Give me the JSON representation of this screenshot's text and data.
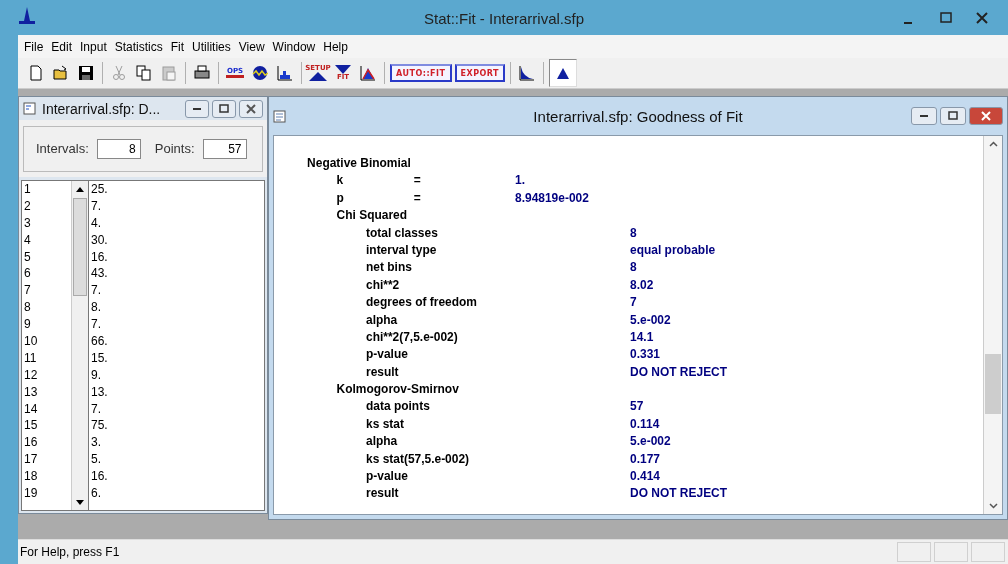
{
  "app_window": {
    "title": "Stat::Fit - Interarrival.sfp"
  },
  "menu": [
    "File",
    "Edit",
    "Input",
    "Statistics",
    "Fit",
    "Utilities",
    "View",
    "Window",
    "Help"
  ],
  "toolbar": [
    {
      "items": [
        {
          "kind": "new",
          "disabled": false,
          "pressed": false
        },
        {
          "kind": "open",
          "disabled": false,
          "pressed": false
        },
        {
          "kind": "save",
          "disabled": false,
          "pressed": false
        }
      ]
    },
    {
      "items": [
        {
          "kind": "cut",
          "disabled": true,
          "pressed": false
        },
        {
          "kind": "copy",
          "disabled": false,
          "pressed": false
        },
        {
          "kind": "paste",
          "disabled": true,
          "pressed": false
        }
      ]
    },
    {
      "items": [
        {
          "kind": "print",
          "disabled": false,
          "pressed": false
        }
      ]
    },
    {
      "items": [
        {
          "kind": "ops",
          "label": "OPS",
          "disabled": false,
          "pressed": false
        },
        {
          "kind": "wave",
          "disabled": false,
          "pressed": false
        },
        {
          "kind": "histogram",
          "disabled": false,
          "pressed": false
        }
      ]
    },
    {
      "items": [
        {
          "kind": "setup",
          "label": "SETUP",
          "disabled": false,
          "pressed": false
        },
        {
          "kind": "fit",
          "label": "FIT",
          "disabled": false,
          "pressed": false
        },
        {
          "kind": "compare",
          "disabled": false,
          "pressed": false
        }
      ]
    },
    {
      "items": [
        {
          "kind": "text",
          "label": "AUTO::FIT",
          "disabled": false,
          "pressed": false
        },
        {
          "kind": "text",
          "label": "EXPORT",
          "disabled": false,
          "pressed": false
        }
      ]
    },
    {
      "items": [
        {
          "kind": "curve",
          "disabled": false,
          "pressed": false
        }
      ]
    },
    {
      "items": [
        {
          "kind": "peak",
          "disabled": false,
          "pressed": true
        }
      ]
    }
  ],
  "data_window": {
    "title": "Interarrival.sfp: D...",
    "intervals_label": "Intervals:",
    "intervals": "8",
    "points_label": "Points:",
    "points": "57",
    "rows": [
      {
        "index": "1",
        "value": "25."
      },
      {
        "index": "2",
        "value": "7."
      },
      {
        "index": "3",
        "value": "4."
      },
      {
        "index": "4",
        "value": "30."
      },
      {
        "index": "5",
        "value": "16."
      },
      {
        "index": "6",
        "value": "43."
      },
      {
        "index": "7",
        "value": "7."
      },
      {
        "index": "8",
        "value": "8."
      },
      {
        "index": "9",
        "value": "7."
      },
      {
        "index": "10",
        "value": "66."
      },
      {
        "index": "11",
        "value": "15."
      },
      {
        "index": "12",
        "value": "9."
      },
      {
        "index": "13",
        "value": "13."
      },
      {
        "index": "14",
        "value": "7."
      },
      {
        "index": "15",
        "value": "75."
      },
      {
        "index": "16",
        "value": "3."
      },
      {
        "index": "17",
        "value": "5."
      },
      {
        "index": "18",
        "value": "16."
      },
      {
        "index": "19",
        "value": "6."
      }
    ]
  },
  "fit_window": {
    "title": "Interarrival.sfp: Goodness of Fit",
    "heading": "Negative Binomial",
    "params": [
      {
        "name": "k",
        "sign": "=",
        "value": "1."
      },
      {
        "name": "p",
        "sign": "=",
        "value": "8.94819e-002"
      }
    ],
    "tests": [
      {
        "name": "Chi Squared",
        "rows": [
          {
            "label": "total classes",
            "value": "8"
          },
          {
            "label": "interval type",
            "value": "equal probable"
          },
          {
            "label": "net bins",
            "value": "8"
          },
          {
            "label": "chi**2",
            "value": "8.02"
          },
          {
            "label": "degrees of freedom",
            "value": "7"
          },
          {
            "label": "alpha",
            "value": "5.e-002"
          },
          {
            "label": "chi**2(7,5.e-002)",
            "value": "14.1"
          },
          {
            "label": "p-value",
            "value": "0.331"
          },
          {
            "label": "result",
            "value": "DO NOT REJECT"
          }
        ]
      },
      {
        "name": "Kolmogorov-Smirnov",
        "rows": [
          {
            "label": "data points",
            "value": "57"
          },
          {
            "label": "ks stat",
            "value": "0.114"
          },
          {
            "label": "alpha",
            "value": "5.e-002"
          },
          {
            "label": "ks stat(57,5.e-002)",
            "value": "0.177"
          },
          {
            "label": "p-value",
            "value": "0.414"
          },
          {
            "label": "result",
            "value": "DO NOT REJECT"
          }
        ]
      }
    ]
  },
  "status_bar": {
    "text": "For Help, press F1"
  }
}
